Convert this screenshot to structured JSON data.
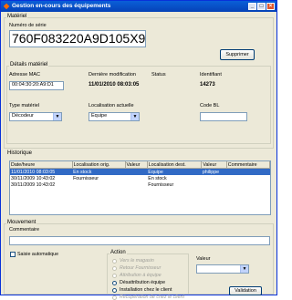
{
  "window": {
    "title": "Gestion en-cours des équipements",
    "controls": {
      "minimize": "_",
      "maximize": "□",
      "close": "×"
    }
  },
  "materiel": {
    "legend": "Matériel",
    "serial_label": "Numéro de série",
    "serial_value": "760F083220A9D105X9",
    "delete_button": "Supprimer",
    "details": {
      "legend": "Détails matériel",
      "mac_label": "Adresse MAC",
      "mac_value": "00:04:30:20:A9:D1",
      "last_mod_label": "Dernière modification",
      "last_mod_value": "11/01/2010 08:03:05",
      "status_label": "Status",
      "status_value": "",
      "id_label": "Identifiant",
      "id_value": "14273",
      "type_label": "Type matériel",
      "type_value": "Décodeur",
      "location_label": "Localisation actuelle",
      "location_value": "Equipe",
      "codebl_label": "Code BL",
      "codebl_value": ""
    }
  },
  "historique": {
    "legend": "Historique",
    "columns": [
      "Date/heure",
      "Localisation orig.",
      "Valeur",
      "Localisation dest.",
      "Valeur",
      "Commentaire"
    ],
    "rows": [
      [
        "11/01/2010 08:03:05",
        "En stock",
        "",
        "Equipe",
        "philippe",
        ""
      ],
      [
        "30/11/2009 10:43:02",
        "Fournisseur",
        "",
        "En stock",
        "",
        ""
      ],
      [
        "30/11/2009 10:43:02",
        "",
        "",
        "Fournisseur",
        "",
        ""
      ]
    ],
    "selected_row": 0
  },
  "mouvement": {
    "legend": "Mouvement",
    "comment_label": "Commentaire",
    "comment_value": "",
    "auto_label": "Saisie automatique",
    "action_legend": "Action",
    "actions": [
      {
        "label": "Vers le magasin",
        "enabled": false
      },
      {
        "label": "Retour Fournisseur",
        "enabled": false
      },
      {
        "label": "Attribution à équipe",
        "enabled": false
      },
      {
        "label": "Désattribution équipe",
        "enabled": true
      },
      {
        "label": "Installation chez le client",
        "enabled": true
      },
      {
        "label": "Récupération de chez le client",
        "enabled": false
      }
    ],
    "value_label": "Valeur",
    "value_value": "",
    "validate_button": "Validation"
  },
  "colors": {
    "titlebar": "#0a5fd8",
    "selection": "#316ac5",
    "window_bg": "#ece9d8"
  }
}
